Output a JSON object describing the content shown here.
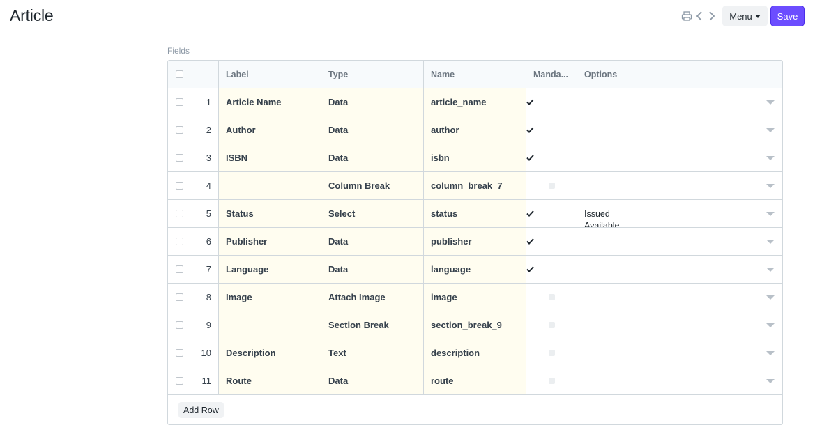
{
  "header": {
    "title": "Article",
    "menu_label": "Menu",
    "save_label": "Save",
    "icons": [
      "printer-icon",
      "chevron-left-icon",
      "chevron-right-icon"
    ]
  },
  "section": {
    "label": "Fields"
  },
  "table": {
    "columns": [
      "Label",
      "Type",
      "Name",
      "Manda...",
      "Options"
    ],
    "rows": [
      {
        "idx": "1",
        "label": "Article Name",
        "type": "Data",
        "name": "article_name",
        "mandatory": true,
        "options": ""
      },
      {
        "idx": "2",
        "label": "Author",
        "type": "Data",
        "name": "author",
        "mandatory": true,
        "options": ""
      },
      {
        "idx": "3",
        "label": "ISBN",
        "type": "Data",
        "name": "isbn",
        "mandatory": true,
        "options": ""
      },
      {
        "idx": "4",
        "label": "",
        "type": "Column Break",
        "name": "column_break_7",
        "mandatory": false,
        "options": ""
      },
      {
        "idx": "5",
        "label": "Status",
        "type": "Select",
        "name": "status",
        "mandatory": true,
        "options": "Issued\nAvailable"
      },
      {
        "idx": "6",
        "label": "Publisher",
        "type": "Data",
        "name": "publisher",
        "mandatory": true,
        "options": ""
      },
      {
        "idx": "7",
        "label": "Language",
        "type": "Data",
        "name": "language",
        "mandatory": true,
        "options": ""
      },
      {
        "idx": "8",
        "label": "Image",
        "type": "Attach Image",
        "name": "image",
        "mandatory": false,
        "options": ""
      },
      {
        "idx": "9",
        "label": "",
        "type": "Section Break",
        "name": "section_break_9",
        "mandatory": false,
        "options": ""
      },
      {
        "idx": "10",
        "label": "Description",
        "type": "Text",
        "name": "description",
        "mandatory": false,
        "options": ""
      },
      {
        "idx": "11",
        "label": "Route",
        "type": "Data",
        "name": "route",
        "mandatory": false,
        "options": ""
      }
    ],
    "add_row_label": "Add Row"
  },
  "colors": {
    "accent": "#6c4dff",
    "editable_cell_bg": "#fffdf0",
    "border": "#d1d8dd"
  }
}
